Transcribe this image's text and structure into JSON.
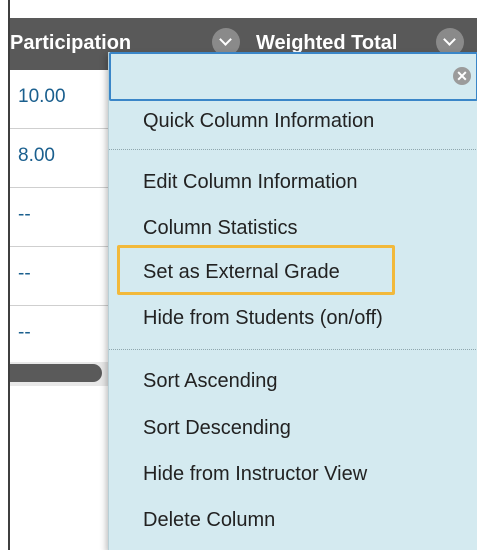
{
  "header": {
    "column1": "Participation",
    "column2": "Weighted Total"
  },
  "rows": [
    "10.00",
    "8.00",
    "--",
    "--",
    "--"
  ],
  "menu": {
    "close_glyph": "✕",
    "items": [
      "Quick Column Information",
      "Edit Column Information",
      "Column Statistics",
      "Set as External Grade",
      "Hide from Students (on/off)",
      "Sort Ascending",
      "Sort Descending",
      "Hide from Instructor View",
      "Delete Column"
    ]
  },
  "colors": {
    "header_bg": "#595959",
    "menu_bg": "#d4eaf0",
    "highlight": "#f2b93b",
    "value_text": "#1a5f8e"
  },
  "icons": [
    "chevron-down-icon",
    "close-icon"
  ]
}
